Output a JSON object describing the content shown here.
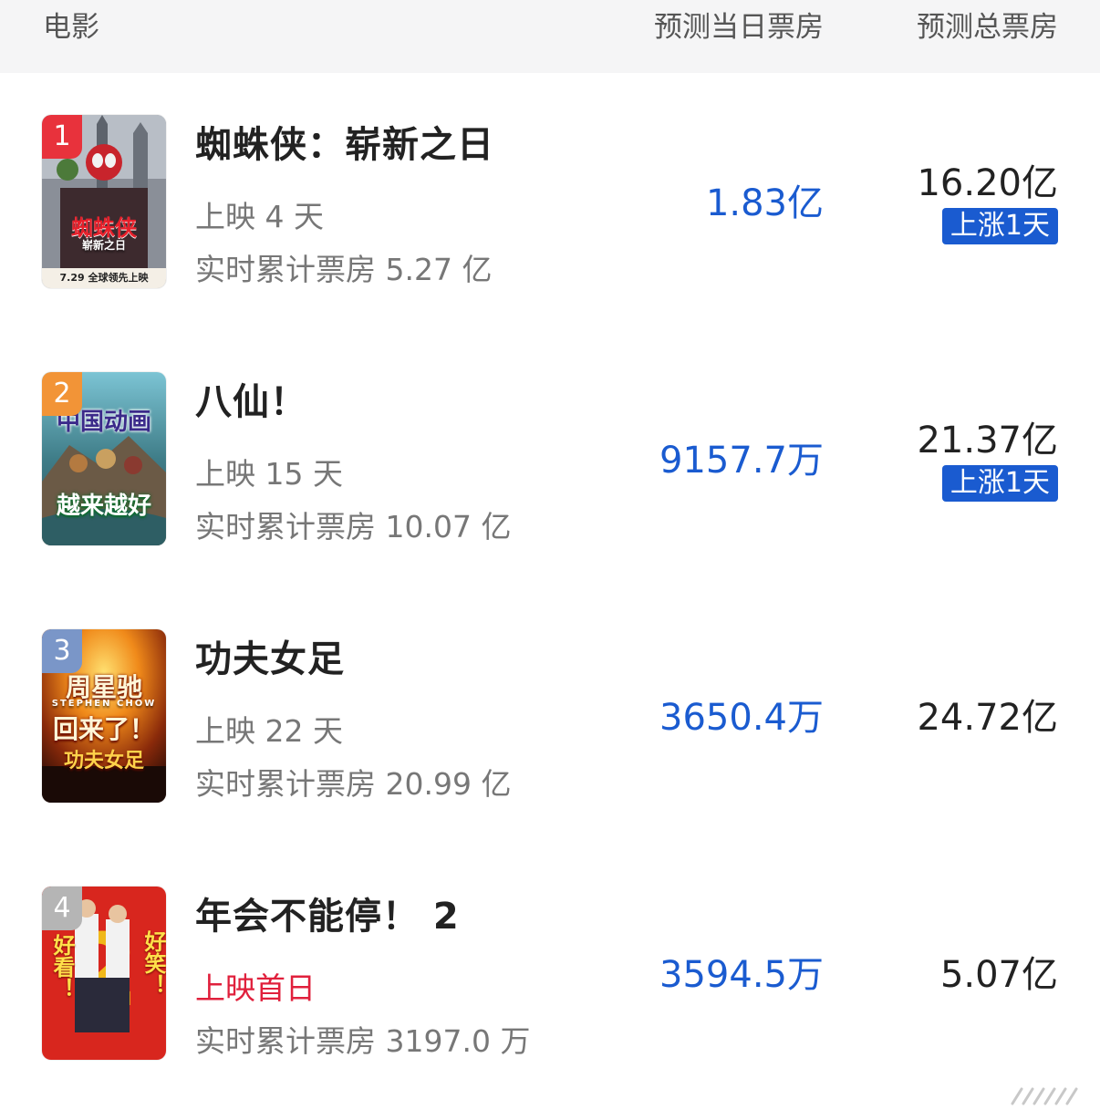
{
  "header": {
    "movie": "电影",
    "today": "预测当日票房",
    "total": "预测总票房"
  },
  "colors": {
    "accent": "#1a5bd0",
    "red": "#e0203c",
    "rank1": "#e8323c",
    "rank2": "#f29437",
    "rank3": "#7a96c8",
    "rank4": "#b5b5b5"
  },
  "movies": [
    {
      "rank": "1",
      "title": "蜘蛛侠：崭新之日",
      "days": "上映 4 天",
      "cumulative": "实时累计票房 5.27 亿",
      "today": "1.83亿",
      "total": "16.20亿",
      "badge": "上涨1天",
      "poster": {
        "line1": "蜘蛛侠",
        "line2": "崭新之日",
        "date": "7.29 全球领先上映"
      }
    },
    {
      "rank": "2",
      "title": "八仙！",
      "days": "上映 15 天",
      "cumulative": "实时累计票房 10.07 亿",
      "today": "9157.7万",
      "total": "21.37亿",
      "badge": "上涨1天",
      "poster": {
        "line1": "中国动画",
        "line2": "越来越好"
      }
    },
    {
      "rank": "3",
      "title": "功夫女足",
      "days": "上映 22 天",
      "cumulative": "实时累计票房 20.99 亿",
      "today": "3650.4万",
      "total": "24.72亿",
      "poster": {
        "line1": "周星驰",
        "line2": "STEPHEN CHOW",
        "line3": "回来了！",
        "line4": "功夫女足"
      }
    },
    {
      "rank": "4",
      "title": "年会不能停！ 2",
      "days": "上映首日",
      "cumulative": "实时累计票房 3197.0 万",
      "today": "3594.5万",
      "total": "5.07亿",
      "poster": {
        "left": "好看！",
        "right": "好笑！"
      }
    }
  ]
}
